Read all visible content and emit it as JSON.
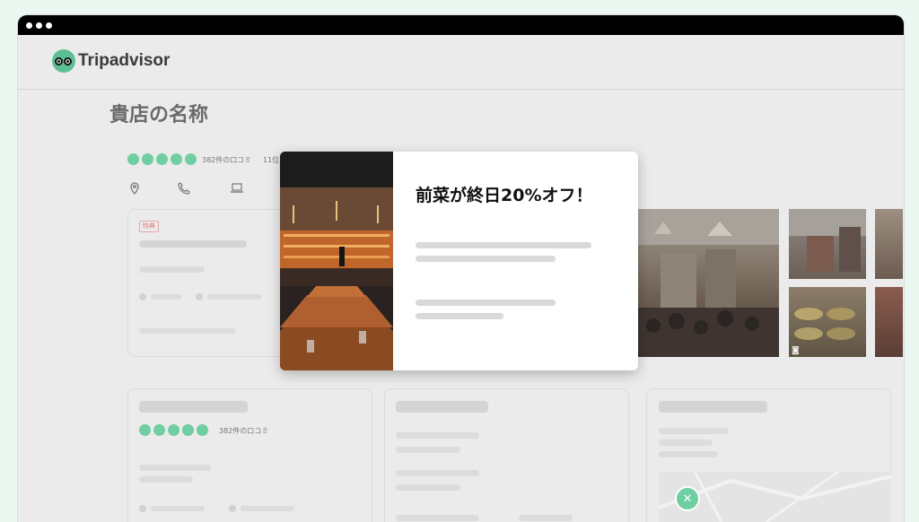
{
  "app": {
    "logo_text": "Tripadvisor"
  },
  "business": {
    "name": "貴店の名称",
    "review_count": "382件の口コミ",
    "rank": "11位"
  },
  "offer_badge": "特典",
  "modal": {
    "title": "前菜が終日20%オフ！"
  },
  "second_card": {
    "review_count": "382件の口コミ"
  },
  "icons": {
    "location": "location-pin-icon",
    "phone": "phone-icon",
    "website": "laptop-icon",
    "camera": "camera-icon",
    "restaurant": "fork-knife-icon"
  },
  "colors": {
    "accent": "#5bbf94",
    "bubble": "#6fcfa2",
    "badge": "#e07b7b"
  }
}
